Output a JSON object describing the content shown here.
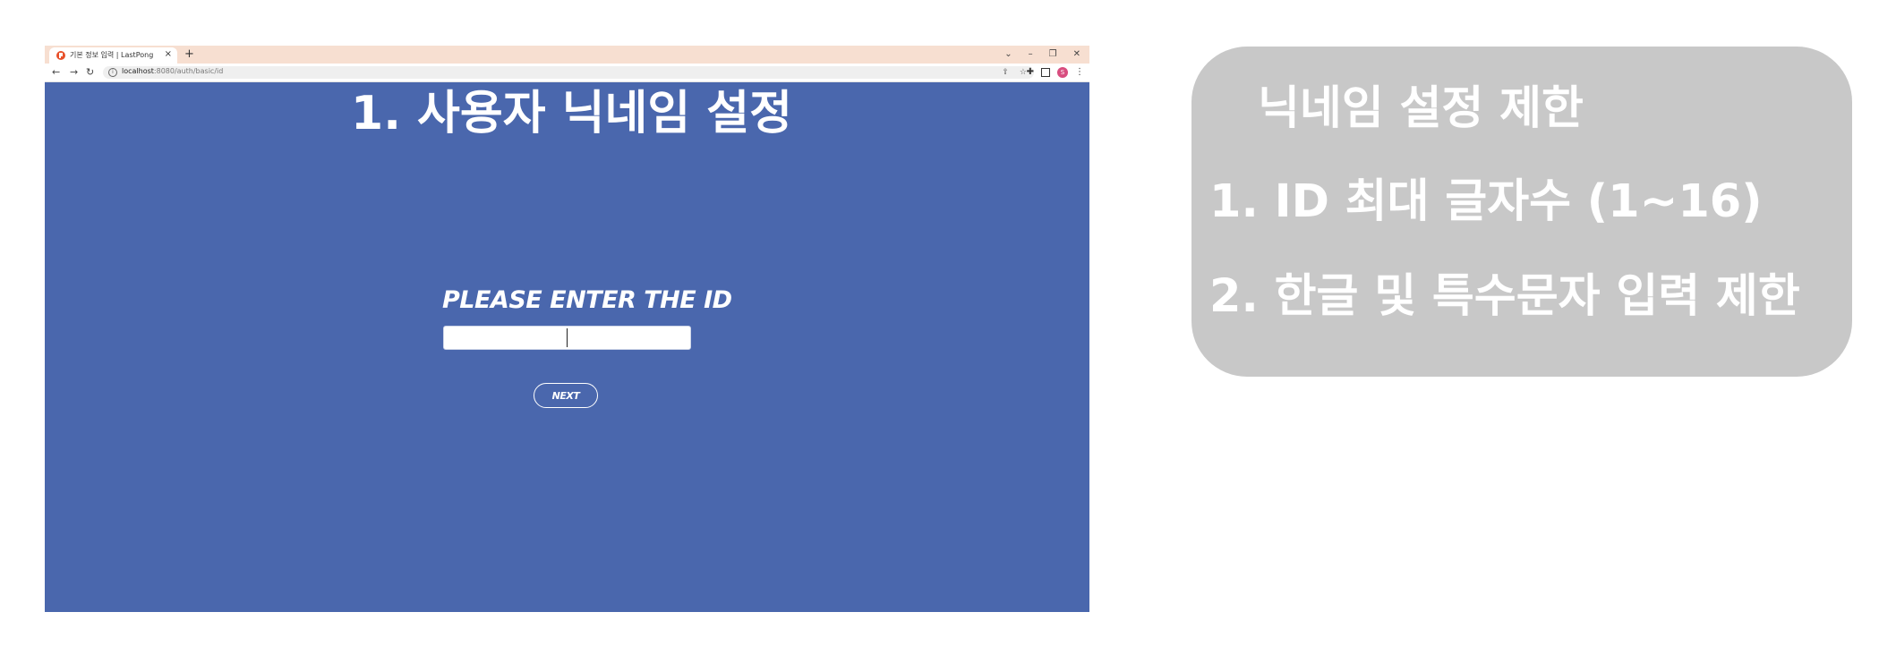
{
  "browser": {
    "tab_title": "기본 정보 입력 | LastPong",
    "tab_close": "×",
    "new_tab": "+",
    "window_controls": {
      "menu": "⌄",
      "minimize": "–",
      "restore": "❐",
      "close": "✕"
    },
    "nav": {
      "back": "←",
      "forward": "→",
      "reload": "↻"
    },
    "address": {
      "host": "localhost",
      "path": ":8080/auth/basic/id"
    },
    "profile_initial": "S",
    "icons": [
      "info-icon",
      "share-icon",
      "star-icon",
      "extensions-icon",
      "side-panel-icon",
      "more-icon"
    ]
  },
  "page": {
    "heading": "1. 사용자 닉네임 설정",
    "id_label": "PLEASE ENTER THE ID",
    "id_input_value": "",
    "next_label": "NEXT",
    "background": "#4a67ad"
  },
  "note": {
    "title": "닉네임 설정 제한",
    "items": [
      "1. ID 최대 글자수 (1~16)",
      "2. 한글 및 특수문자 입력 제한"
    ],
    "background": "#c8c8c8"
  }
}
